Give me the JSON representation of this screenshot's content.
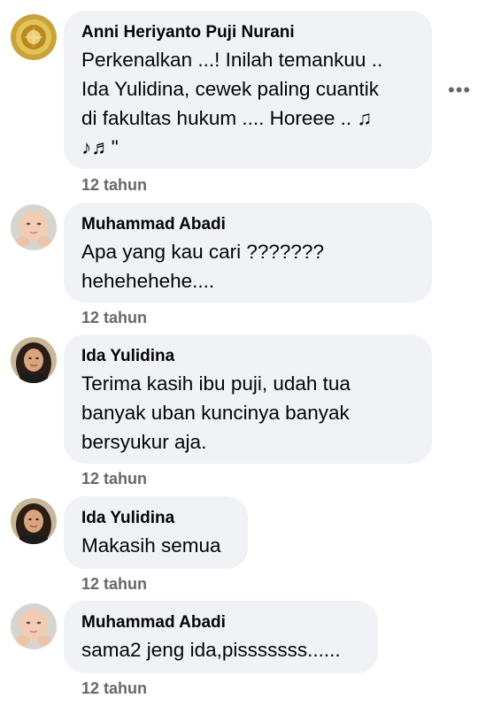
{
  "comments": [
    {
      "author": "Anni Heriyanto Puji Nurani",
      "lines": [
        "Perkenalkan ...! Inilah temankuu ..",
        "Ida Yulidina, cewek paling cuantik",
        "di fakultas hukum .... Horeee .. ♫",
        "♪♬\""
      ],
      "time": "12 tahun",
      "avatar": "gold-emblem-avatar"
    },
    {
      "author": "Muhammad Abadi",
      "lines": [
        "Apa yang kau cari ???????",
        "hehehehehe...."
      ],
      "time": "12 tahun",
      "avatar": "baby-photo-avatar"
    },
    {
      "author": "Ida Yulidina",
      "lines": [
        "Terima kasih ibu puji, udah tua",
        "banyak uban kuncinya banyak",
        "bersyukur aja."
      ],
      "time": "12 tahun",
      "avatar": "woman-photo-avatar"
    },
    {
      "author": "Ida Yulidina",
      "lines": [
        "Makasih semua"
      ],
      "time": "12 tahun",
      "avatar": "woman-photo-avatar"
    },
    {
      "author": "Muhammad Abadi",
      "lines": [
        "sama2 jeng ida,pisssssss......"
      ],
      "time": "12 tahun",
      "avatar": "baby-photo-avatar"
    }
  ],
  "more_menu_label": "•••"
}
